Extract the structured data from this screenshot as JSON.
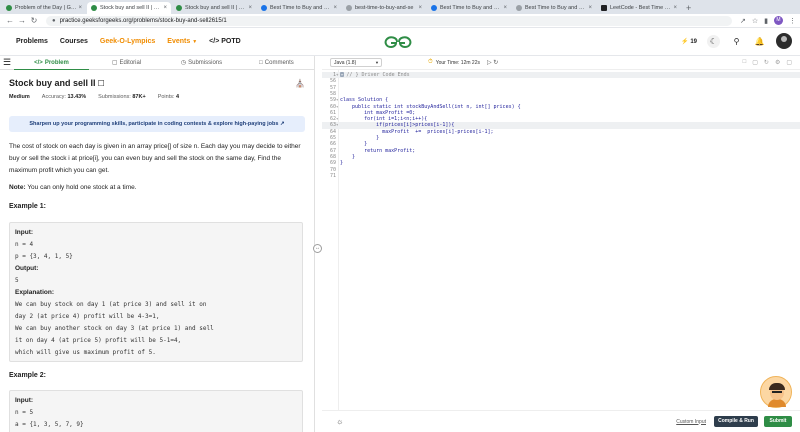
{
  "browser": {
    "tabs": [
      {
        "title": "Problem of the Day | Geek",
        "icon": "gfg-icon",
        "active": false
      },
      {
        "title": "Stock buy and sell II | Prac",
        "icon": "gfg-icon",
        "active": true
      },
      {
        "title": "Stock buy and sell II | Prac",
        "icon": "gfg-icon",
        "active": false
      },
      {
        "title": "Best Time to Buy and Sell",
        "icon": "blue-icon",
        "active": false
      },
      {
        "title": "best-time-to-buy-and-se",
        "icon": "gray-icon",
        "active": false
      },
      {
        "title": "Best Time to Buy and Sell",
        "icon": "blue-icon",
        "active": false
      },
      {
        "title": "Best Time to Buy and Sell",
        "icon": "gray-icon",
        "active": false
      },
      {
        "title": "LeetCode - Best Time to B",
        "icon": "dark-icon",
        "active": false
      }
    ],
    "url": "practice.geeksforgeeks.org/problems/stock-buy-and-sell2615/1",
    "profile_initial": "M"
  },
  "header": {
    "nav": [
      "Problems",
      "Courses",
      "Geek-O-Lympics",
      "Events",
      "POTD"
    ],
    "streak": "19",
    "colors": {
      "brand": "#2f8d46",
      "orange": "#f08c00"
    }
  },
  "problem": {
    "tabs": [
      "Problem",
      "Editorial",
      "Submissions",
      "Comments"
    ],
    "title": "Stock buy and sell II",
    "difficulty": "Medium",
    "accuracy_label": "Accuracy:",
    "accuracy": "13.43%",
    "submissions_label": "Submissions:",
    "submissions": "87K+",
    "points_label": "Points:",
    "points": "4",
    "banner": "Sharpen up your programming skills, participate in coding contests & explore high-paying jobs",
    "statement": "The cost of stock on each day is given in an array price[] of size n. Each day you may decide to either buy or sell the stock i at price[i], you can even buy and sell the stock on the same day, Find the maximum profit which you can get.",
    "note_label": "Note:",
    "note_text": "You can only hold one stock at a time.",
    "examples": [
      {
        "heading": "Example 1:",
        "input_label": "Input:",
        "input_lines": [
          "n = 4",
          "p = {3, 4, 1, 5}"
        ],
        "output_label": "Output:",
        "output": "5",
        "explanation_label": "Explanation:",
        "explanation_lines": [
          "We can buy stock on day 1 (at price 3) and sell it on",
          "day 2 (at price 4) profit will be 4-3=1,",
          "We can buy another stock on day 3 (at price 1) and sell",
          "it on day 4 (at price 5) profit will be 5-1=4,",
          "which will give us maximum profit of 5."
        ]
      },
      {
        "heading": "Example 2:",
        "input_label": "Input:",
        "input_lines": [
          "n = 5",
          "a = {1, 3, 5, 7, 9}"
        ]
      }
    ]
  },
  "editor": {
    "language": "Java (1.8)",
    "timer": "Your Time: 12m 22s",
    "code_lines": [
      {
        "n": "1",
        "fold": "+",
        "marker": "↔",
        "text": "// } Driver Code Ends",
        "comment": true,
        "hl": true
      },
      {
        "n": "56",
        "fold": "",
        "text": ""
      },
      {
        "n": "57",
        "fold": "",
        "text": ""
      },
      {
        "n": "58",
        "fold": "",
        "text": ""
      },
      {
        "n": "59",
        "fold": "▾",
        "text": "class Solution {"
      },
      {
        "n": "60",
        "fold": "▾",
        "text": "    public static int stockBuyAndSell(int n, int[] prices) {"
      },
      {
        "n": "61",
        "fold": "",
        "text": "        int maxProfit =0;"
      },
      {
        "n": "62",
        "fold": "▾",
        "text": "        for(int i=1;i<n;i++){"
      },
      {
        "n": "63",
        "fold": "▾",
        "text": "            if(prices[i]>prices[i-1]){",
        "hl": true
      },
      {
        "n": "64",
        "fold": "",
        "text": "              maxProfit  +=  prices[i]-prices[i-1];"
      },
      {
        "n": "65",
        "fold": "",
        "text": "            }"
      },
      {
        "n": "66",
        "fold": "",
        "text": "        }"
      },
      {
        "n": "67",
        "fold": "",
        "text": "        return maxProfit;"
      },
      {
        "n": "68",
        "fold": "",
        "text": "    }"
      },
      {
        "n": "69",
        "fold": "",
        "text": "}"
      },
      {
        "n": "70",
        "fold": "",
        "text": ""
      },
      {
        "n": "71",
        "fold": "",
        "text": ""
      }
    ],
    "custom_input": "Custom Input",
    "compile_label": "Compile & Run",
    "submit_label": "Submit"
  }
}
